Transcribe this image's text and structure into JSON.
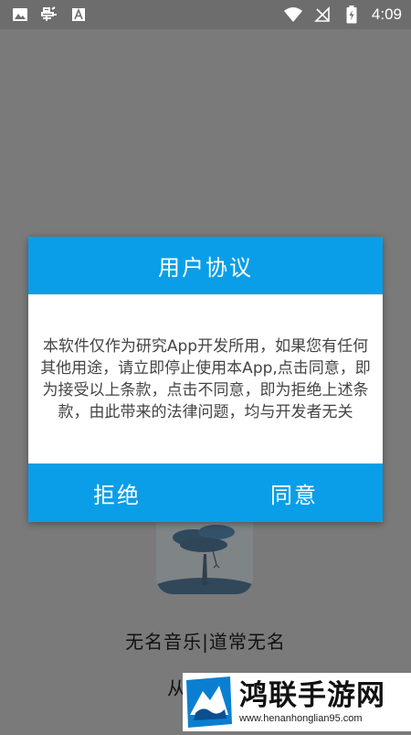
{
  "status_bar": {
    "time": "4:09",
    "icons_left": [
      "image-icon",
      "bug-icon",
      "text-a-icon"
    ],
    "icons_right": [
      "wifi-icon",
      "no-signal-icon",
      "battery-charging-icon"
    ]
  },
  "background": {
    "app_title": "无名音乐|道常无名",
    "subtitle_partial": "从"
  },
  "dialog": {
    "title": "用户协议",
    "body": "本软件仅作为研究App开发所用，如果您有任何其他用途，请立即停止使用本App,点击同意，即为接受以上条款，点击不同意，即为拒绝上述条款，由此带来的法律问题，均与开发者无关",
    "reject_label": "拒绝",
    "agree_label": "同意",
    "accent_color": "#0a9ee8"
  },
  "watermark": {
    "title": "鸿联手游网",
    "url": "www.henanhonglian95.com"
  }
}
